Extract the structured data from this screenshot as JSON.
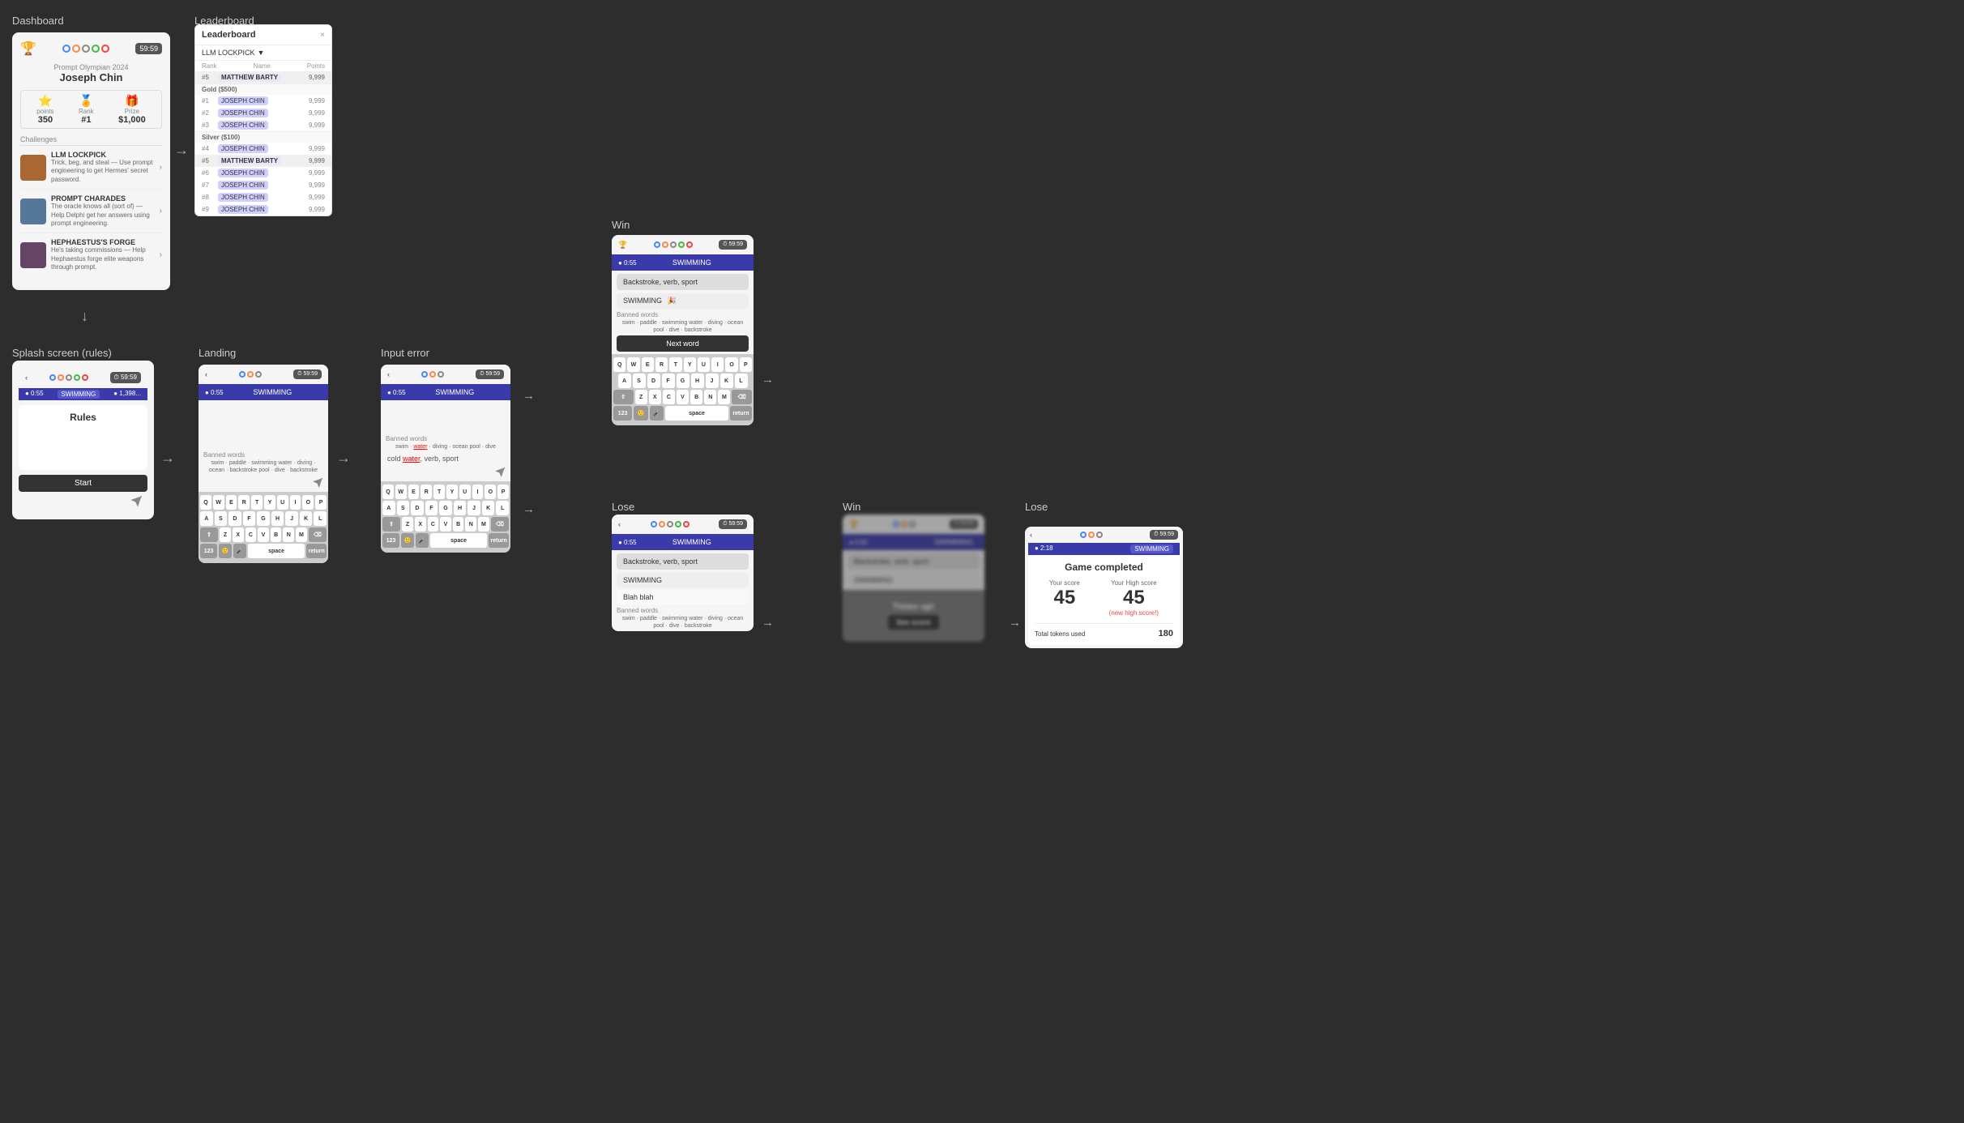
{
  "labels": {
    "dashboard": "Dashboard",
    "leaderboard": "Leaderboard",
    "splash": "Splash screen (rules)",
    "landing": "Landing",
    "input_error": "Input error",
    "win": "Win",
    "lose": "Lose",
    "win2": "Win",
    "lose2": "Lose"
  },
  "dashboard": {
    "user": "Joseph Chin",
    "timer": "59:59",
    "points": "350",
    "points_label": "points",
    "rank": "#1",
    "rank_label": "Rank",
    "prize": "$1,000",
    "prize_label": "Prize",
    "challenges_label": "Challenges",
    "challenges": [
      {
        "title": "LLM LOCKPICK",
        "desc": "Trick, beg, and steal — Use prompt engineering to get Hermes' secret password."
      },
      {
        "title": "PROMPT CHARADES",
        "desc": "The oracle knows all (sort of) — Help Delphi get her answers using prompt engineering."
      },
      {
        "title": "HEPHAESTUS'S FORGE",
        "desc": "He's taking commissions — Help Hephaestus forge elite weapons through prompt."
      }
    ]
  },
  "leaderboard": {
    "title": "Leaderboard",
    "filter": "LLM LOCKPICK",
    "close": "×",
    "cols": {
      "rank": "Rank",
      "name": "Name",
      "points": "Points"
    },
    "top_row": {
      "rank": "#5",
      "name": "MATTHEW BARTY",
      "points": "9,999"
    },
    "gold_label": "Gold ($500)",
    "gold_rows": [
      {
        "rank": "#1",
        "name": "JOSEPH CHIN",
        "points": "9,999"
      },
      {
        "rank": "#2",
        "name": "JOSEPH CHIN",
        "points": "9,999"
      },
      {
        "rank": "#3",
        "name": "JOSEPH CHIN",
        "points": "9,999"
      }
    ],
    "silver_label": "Silver ($100)",
    "silver_rows": [
      {
        "rank": "#4",
        "name": "JOSEPH CHIN",
        "points": "9,999"
      },
      {
        "rank": "#5",
        "name": "MATTHEW BARTY",
        "points": "9,999"
      },
      {
        "rank": "#6",
        "name": "JOSEPH CHIN",
        "points": "9,999"
      },
      {
        "rank": "#7",
        "name": "JOSEPH CHIN",
        "points": "9,999"
      },
      {
        "rank": "#8",
        "name": "JOSEPH CHIN",
        "points": "9,999"
      },
      {
        "rank": "#9",
        "name": "JOSEPH CHIN",
        "points": "9,999"
      }
    ]
  },
  "phone": {
    "timer": "59:59",
    "word": "SWIMMING",
    "time_left": "0:55",
    "clue": "Backstroke, verb, sport",
    "answer": "SWIMMING",
    "banned_title": "Banned words",
    "banned": [
      "swim",
      "paddle",
      "swimming",
      "water",
      "diving",
      "ocean",
      "pool",
      "dive",
      "backstroke"
    ],
    "next_word": "Next word",
    "keyboard_rows": [
      [
        "Q",
        "W",
        "E",
        "R",
        "T",
        "Y",
        "U",
        "I",
        "O",
        "P"
      ],
      [
        "A",
        "S",
        "D",
        "F",
        "G",
        "H",
        "J",
        "K",
        "L"
      ],
      [
        "⇧",
        "Z",
        "X",
        "C",
        "V",
        "B",
        "N",
        "M",
        "⌫"
      ]
    ],
    "bottom_keys": [
      "123",
      "🙂",
      "🎤",
      "space",
      "return"
    ]
  },
  "splash": {
    "rules_title": "Rules",
    "start": "Start"
  },
  "input_error": {
    "error_word": "water",
    "clue": "cold water, verb, sport",
    "word": "SWIMMING"
  },
  "win": {
    "clue": "Backstroke, verb, sport",
    "answer": "SWIMMING",
    "emoji": "🎉"
  },
  "lose": {
    "clue": "Backstroke, verb, sport",
    "answer": "SWIMMING",
    "user_answer": "Blah blah",
    "times_up": "Times up!",
    "see_score": "See score"
  },
  "win_result": {
    "blurred": true
  },
  "game_completed": {
    "title": "Game completed",
    "your_score_label": "Your score",
    "high_score_label": "Your High score",
    "your_score": "45",
    "high_score": "45",
    "new_high": "(new high score!)",
    "tokens_label": "Total tokens used",
    "tokens": "180"
  }
}
